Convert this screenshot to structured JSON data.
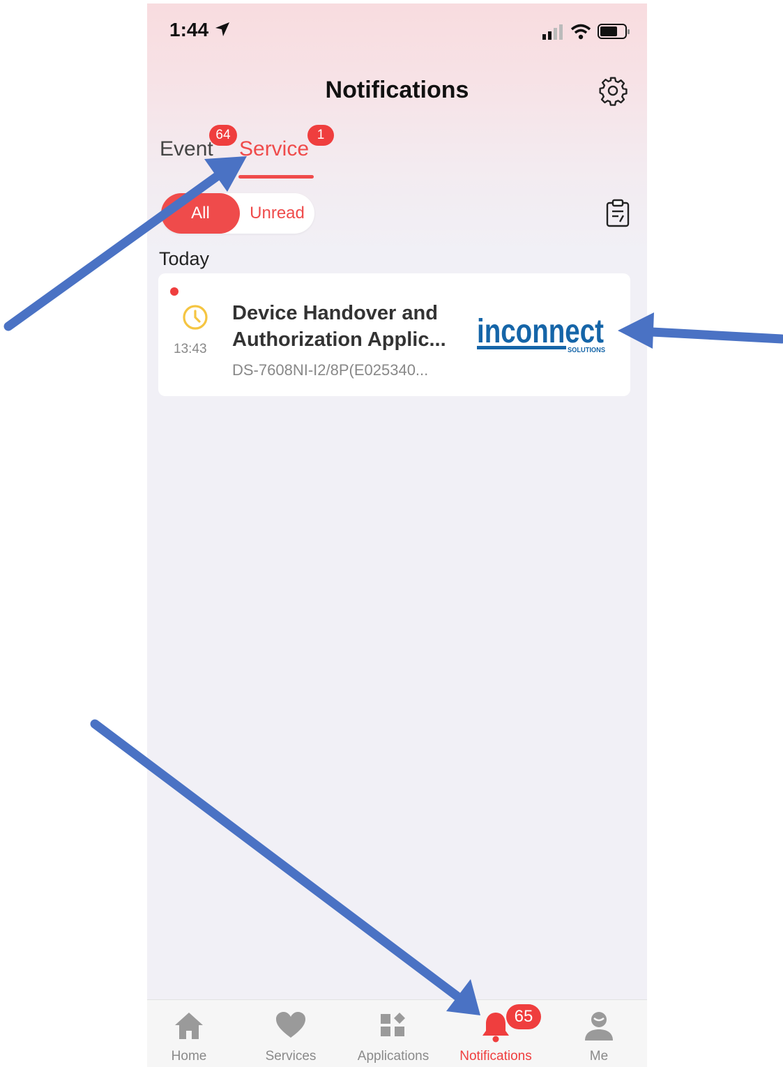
{
  "status_bar": {
    "time": "1:44"
  },
  "header": {
    "title": "Notifications"
  },
  "tabs": [
    {
      "label": "Event",
      "badge": "64"
    },
    {
      "label": "Service",
      "badge": "1",
      "active": true
    }
  ],
  "filter": {
    "all_label": "All",
    "unread_label": "Unread",
    "selected": "All"
  },
  "section": {
    "label": "Today"
  },
  "notification": {
    "time": "13:43",
    "title": "Device Handover and Authorization Applic...",
    "subtitle": "DS-7608NI-I2/8P(E025340...",
    "logo_text": "inconnect",
    "logo_subtext": "SOLUTIONS",
    "unread": true
  },
  "bottom_nav": {
    "items": [
      {
        "label": "Home",
        "icon": "home-icon"
      },
      {
        "label": "Services",
        "icon": "heart-icon"
      },
      {
        "label": "Applications",
        "icon": "apps-icon"
      },
      {
        "label": "Notifications",
        "icon": "bell-icon",
        "active": true,
        "badge": "65"
      },
      {
        "label": "Me",
        "icon": "person-icon"
      }
    ]
  },
  "colors": {
    "accent": "#ef4b4b",
    "badge": "#ef3e3e",
    "annotation_arrow": "#4a72c4",
    "logo_blue": "#1565a8"
  }
}
